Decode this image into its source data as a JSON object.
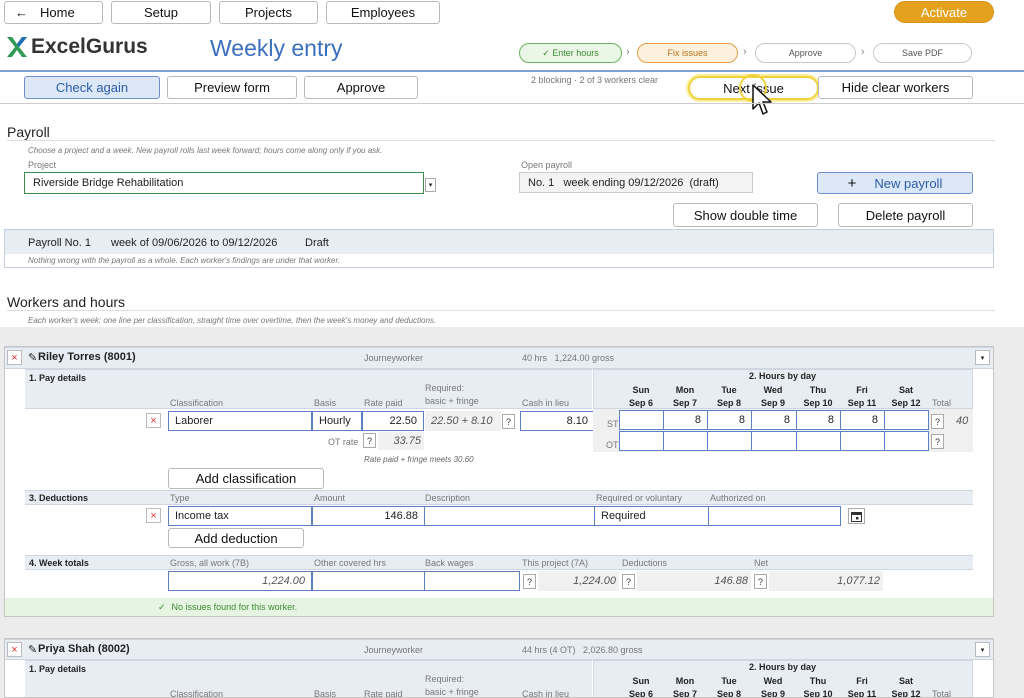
{
  "nav": {
    "home": "Home",
    "setup": "Setup",
    "projects": "Projects",
    "employees": "Employees",
    "activate": "Activate"
  },
  "brand": {
    "logo_text": "ExcelGurus",
    "title": "Weekly entry"
  },
  "steps": [
    "✓ Enter hours",
    "Fix issues",
    "Approve",
    "Save PDF"
  ],
  "toolbar": {
    "check_again": "Check again",
    "preview": "Preview form",
    "approve": "Approve",
    "status": "2 blocking · 2 of 3 workers clear",
    "next_issue": "Next issue",
    "hide_clear": "Hide clear workers"
  },
  "payroll": {
    "heading": "Payroll",
    "hint": "Choose a project and a week. New payroll rolls last week forward; hours come along only if you ask.",
    "project_label": "Project",
    "project_value": "Riverside Bridge Rehabilitation",
    "open_label": "Open payroll",
    "open_value": "No. 1   week ending 09/12/2026  (draft)",
    "new_payroll": "New payroll",
    "show_double": "Show double time",
    "delete": "Delete payroll",
    "summary_no": "Payroll No. 1",
    "summary_week": "week of 09/06/2026 to 09/12/2026",
    "summary_status": "Draft",
    "summary_note": "Nothing wrong with the payroll as a whole. Each worker's findings are under that worker."
  },
  "workers_section": {
    "heading": "Workers and hours",
    "hint": "Each worker's week: one line per classification, straight time over overtime, then the week's money and deductions."
  },
  "labels": {
    "pay_details": "1. Pay details",
    "deductions": "3. Deductions",
    "week_totals": "4. Week totals",
    "hours_by_day": "2. Hours by day",
    "classification": "Classification",
    "basis": "Basis",
    "rate_paid": "Rate paid",
    "required": "Required:",
    "basic_fringe": "basic + fringe",
    "cash_lieu": "Cash in lieu",
    "total": "Total",
    "st": "ST",
    "ot": "OT",
    "ot_rate": "OT rate",
    "fringe_note": "Rate paid + fringe meets 30.60",
    "add_class": "Add classification",
    "type": "Type",
    "amount": "Amount",
    "description": "Description",
    "req_vol": "Required or voluntary",
    "authorized": "Authorized on",
    "add_deduction": "Add deduction",
    "gross": "Gross, all work (7B)",
    "other_hrs": "Other covered hrs",
    "back_wages": "Back wages",
    "this_project": "This project (7A)",
    "deductions_col": "Deductions",
    "net": "Net",
    "q": "?"
  },
  "days": [
    {
      "d": "Sun",
      "date": "Sep 6"
    },
    {
      "d": "Mon",
      "date": "Sep 7"
    },
    {
      "d": "Tue",
      "date": "Sep 8"
    },
    {
      "d": "Wed",
      "date": "Sep 9"
    },
    {
      "d": "Thu",
      "date": "Sep 10"
    },
    {
      "d": "Fri",
      "date": "Sep 11"
    },
    {
      "d": "Sat",
      "date": "Sep 12"
    }
  ],
  "worker1": {
    "name": "Riley Torres (8001)",
    "role": "Journeyworker",
    "summary": "40 hrs   1,224.00 gross",
    "classification": "Laborer",
    "basis": "Hourly",
    "rate": "22.50",
    "required": "22.50 + 8.10",
    "cash": "8.10",
    "ot_rate": "33.75",
    "st_hours": [
      "",
      "8",
      "8",
      "8",
      "8",
      "8",
      ""
    ],
    "st_total": "40",
    "ded_type": "Income tax",
    "ded_amount": "146.88",
    "ded_req": "Required",
    "gross": "1,224.00",
    "this_project": "1,224.00",
    "deductions": "146.88",
    "net": "1,077.12",
    "ok": "No issues found for this worker."
  },
  "worker2": {
    "name": "Priya Shah (8002)",
    "role": "Journeyworker",
    "summary": "44 hrs (4 OT)   2,026.80 gross"
  }
}
